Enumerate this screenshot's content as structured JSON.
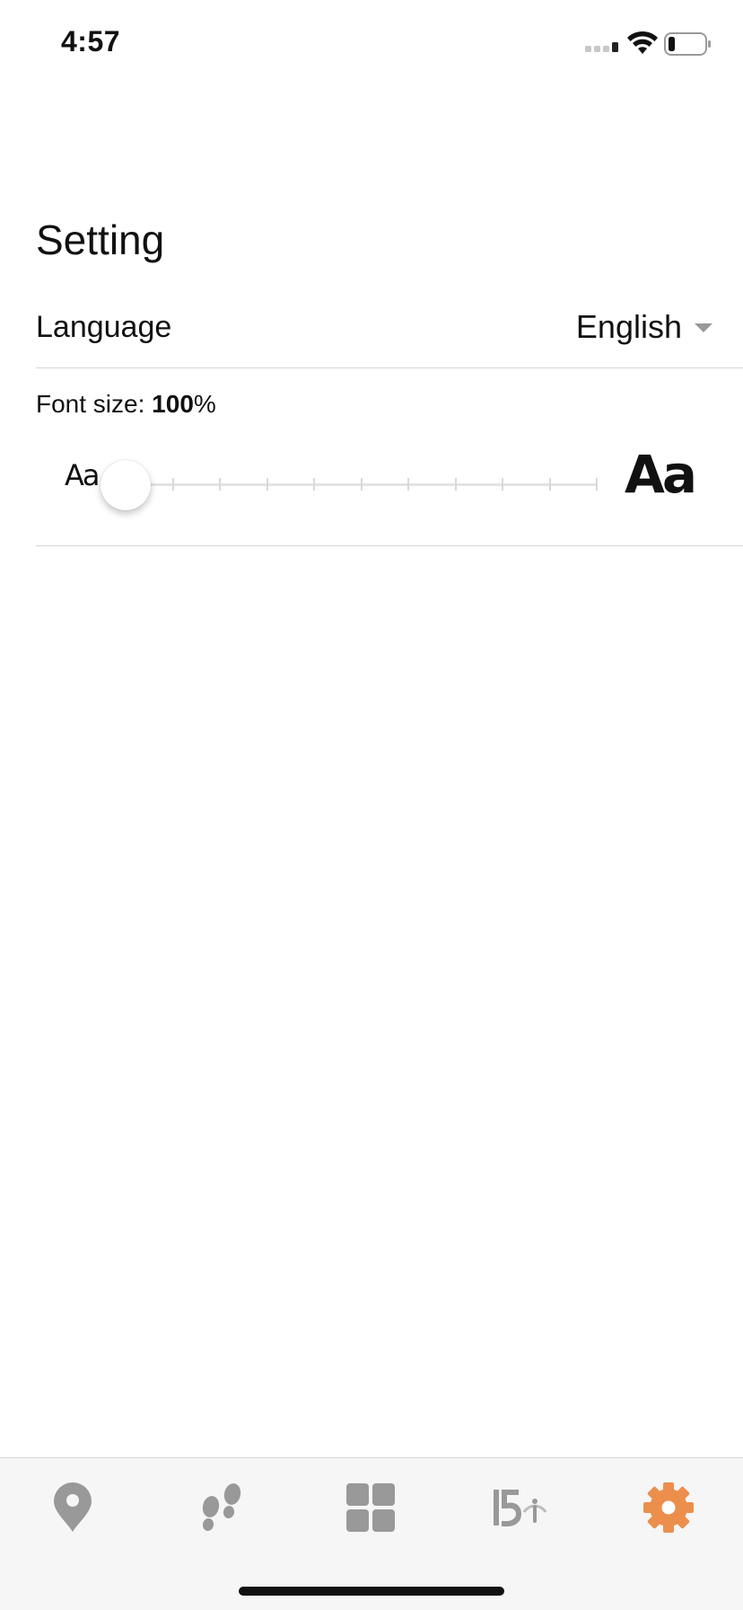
{
  "status_bar": {
    "time": "4:57",
    "signal_icon": "cellular-signal-icon",
    "wifi_icon": "wifi-icon",
    "battery_icon": "battery-low-icon"
  },
  "page": {
    "title": "Setting"
  },
  "language": {
    "label": "Language",
    "value": "English"
  },
  "font_size": {
    "label_prefix": "Font size: ",
    "value": "100",
    "unit": "%",
    "small_sample": "Aa",
    "large_sample": "Aa",
    "slider_value_fraction": 0,
    "steps": 10
  },
  "tab_bar": {
    "tabs": [
      {
        "icon": "map-pin-icon",
        "active": false
      },
      {
        "icon": "footprints-icon",
        "active": false
      },
      {
        "icon": "grid-icon",
        "active": false
      },
      {
        "icon": "anniversary-150-icon",
        "active": false
      },
      {
        "icon": "gear-icon",
        "active": true
      }
    ],
    "active_color": "#ec8f4c",
    "inactive_color": "#999999"
  }
}
